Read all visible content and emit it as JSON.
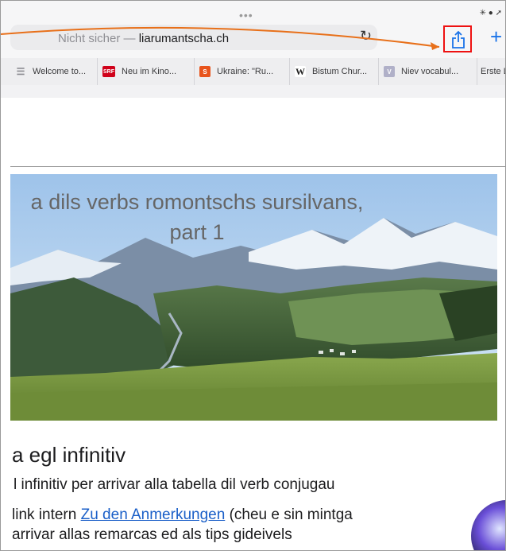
{
  "browser": {
    "url_prefix": "Nicht sicher — ",
    "url_host": "liarumantscha.ch",
    "status_glyphs": "✳ ● ➚"
  },
  "tabs": [
    {
      "label": "Welcome to...",
      "icon": "document-icon",
      "color": "#8e8e93"
    },
    {
      "label": "Neu im Kino...",
      "icon": "srf-icon",
      "icon_text": "SRF",
      "color": "#d0021b"
    },
    {
      "label": "Ukraine: \"Ru...",
      "icon": "s-icon",
      "icon_text": "S",
      "color": "#e8541c"
    },
    {
      "label": "Bistum Chur...",
      "icon": "wikipedia-icon",
      "icon_text": "W",
      "color": "#ffffff"
    },
    {
      "label": "Niev vocabul...",
      "icon": "v-icon",
      "icon_text": "V",
      "color": "#b0b0c8"
    },
    {
      "label": "Erste L"
    }
  ],
  "hero": {
    "title_line1": "a dils verbs romontschs sursilvans,",
    "title_line2": "part 1"
  },
  "content": {
    "heading": "a egl infinitiv",
    "para1": "l infinitiv per arrivar alla tabella dil verb conjugau",
    "para2_pre": "link intern ",
    "para2_link": "Zu den Anmerkungen",
    "para2_post": " (cheu e sin mintga",
    "para3": "arrivar allas remarcas ed als tips gideivels"
  },
  "colors": {
    "highlight": "#e11111",
    "annotation_arrow": "#e8701a",
    "link": "#1a5fc8"
  }
}
